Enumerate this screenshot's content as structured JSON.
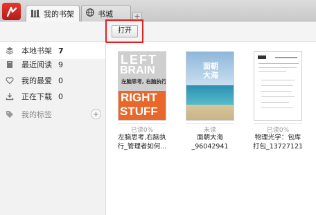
{
  "tabs": [
    {
      "label": "我的书架",
      "icon": "bookshelf-icon",
      "active": true
    },
    {
      "label": "书城",
      "icon": "globe-icon",
      "active": false
    }
  ],
  "tab_add_label": "+",
  "toolbar": {
    "open_label": "打开",
    "highlight_color": "#e02020"
  },
  "sidebar": {
    "items": [
      {
        "label": "本地书架",
        "count": "7",
        "icon": "stack-icon",
        "selected": true
      },
      {
        "label": "最近阅读",
        "count": "9",
        "icon": "book-icon"
      },
      {
        "label": "我的最爱",
        "count": "0",
        "icon": "heart-icon"
      },
      {
        "label": "正在下载",
        "count": "0",
        "icon": "download-icon"
      },
      {
        "label": "我的标签",
        "count": "",
        "icon": "tag-icon"
      }
    ],
    "add_tag_label": "+"
  },
  "books": [
    {
      "status": "已读0%",
      "title_line1": "左脑思考,右脑执",
      "title_line2": "行_管理者如何...",
      "cover_text": {
        "top": "LEFT",
        "mid": "BRAIN",
        "banner": "左脑思考, 右脑执行",
        "bottom1": "RIGHT",
        "bottom2": "STUFF"
      }
    },
    {
      "status": "未读",
      "title_line1": "面朝大海_96042941",
      "title_line2": "",
      "cover_text": {
        "title": "面朝大海"
      }
    },
    {
      "status": "已读0%",
      "title_line1": "物理光学：包库",
      "title_line2": "打包_13727121",
      "cover_text": {}
    }
  ],
  "colors": {
    "accent_red": "#d9261f",
    "sidebar_bg": "#f2f2f2",
    "orange": "#e8672a"
  }
}
